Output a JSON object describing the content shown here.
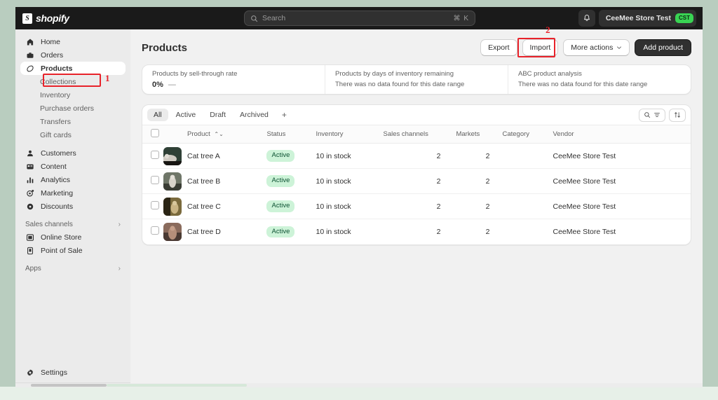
{
  "topbar": {
    "logo_text": "shopify",
    "logo_mark": "S",
    "search_placeholder": "Search",
    "search_shortcut": "⌘ K",
    "bell_icon": "bell-icon",
    "store_name": "CeeMee Store Test",
    "store_badge": "CST"
  },
  "sidebar": {
    "items": [
      {
        "label": "Home",
        "icon": "home-icon",
        "active": false
      },
      {
        "label": "Orders",
        "icon": "orders-icon",
        "active": false
      },
      {
        "label": "Products",
        "icon": "products-tag-icon",
        "active": true
      }
    ],
    "sub_items": [
      {
        "label": "Collections"
      },
      {
        "label": "Inventory"
      },
      {
        "label": "Purchase orders"
      },
      {
        "label": "Transfers"
      },
      {
        "label": "Gift cards"
      }
    ],
    "items2": [
      {
        "label": "Customers",
        "icon": "customers-icon"
      },
      {
        "label": "Content",
        "icon": "content-icon"
      },
      {
        "label": "Analytics",
        "icon": "analytics-icon"
      },
      {
        "label": "Marketing",
        "icon": "marketing-icon"
      },
      {
        "label": "Discounts",
        "icon": "discounts-icon"
      }
    ],
    "sales_channels_label": "Sales channels",
    "channels": [
      {
        "label": "Online Store",
        "icon": "online-store-icon"
      },
      {
        "label": "Point of Sale",
        "icon": "point-of-sale-icon"
      }
    ],
    "apps_label": "Apps",
    "settings_label": "Settings",
    "settings_icon": "gear-icon"
  },
  "page": {
    "title": "Products",
    "export_label": "Export",
    "import_label": "Import",
    "more_actions_label": "More actions",
    "add_product_label": "Add product"
  },
  "annotations": [
    {
      "number": "1",
      "target": "sidebar-item-products"
    },
    {
      "number": "2",
      "target": "import-button"
    }
  ],
  "insights": [
    {
      "label": "Products by sell-through rate",
      "value": "0%",
      "delta": "—",
      "empty": ""
    },
    {
      "label": "Products by days of inventory remaining",
      "value": "",
      "delta": "",
      "empty": "There was no data found for this date range"
    },
    {
      "label": "ABC product analysis",
      "value": "",
      "delta": "",
      "empty": "There was no data found for this date range"
    }
  ],
  "tabs": [
    {
      "label": "All",
      "active": true
    },
    {
      "label": "Active",
      "active": false
    },
    {
      "label": "Draft",
      "active": false
    },
    {
      "label": "Archived",
      "active": false
    }
  ],
  "tab_add_label": "+",
  "tools": {
    "search_filter_icon": "search-filter-icon",
    "sort_icon": "sort-icon"
  },
  "table": {
    "columns": [
      "Product",
      "Status",
      "Inventory",
      "Sales channels",
      "Markets",
      "Category",
      "Vendor"
    ],
    "sort_indicator": "⌃⌄",
    "rows": [
      {
        "product": "Cat tree A",
        "status": "Active",
        "inventory": "10 in stock",
        "sales_channels": "2",
        "markets": "2",
        "category": "",
        "vendor": "CeeMee Store Test",
        "thumb_colors": [
          "#2f4036",
          "#cfcac2",
          "#171512"
        ]
      },
      {
        "product": "Cat tree B",
        "status": "Active",
        "inventory": "10 in stock",
        "sales_channels": "2",
        "markets": "2",
        "category": "",
        "vendor": "CeeMee Store Test",
        "thumb_colors": [
          "#6f7668",
          "#d8d4cb",
          "#3a3d35"
        ]
      },
      {
        "product": "Cat tree C",
        "status": "Active",
        "inventory": "10 in stock",
        "sales_channels": "2",
        "markets": "2",
        "category": "",
        "vendor": "CeeMee Store Test",
        "thumb_colors": [
          "#7a6a3c",
          "#c9b484",
          "#2a2414"
        ]
      },
      {
        "product": "Cat tree D",
        "status": "Active",
        "inventory": "10 in stock",
        "sales_channels": "2",
        "markets": "2",
        "category": "",
        "vendor": "CeeMee Store Test",
        "thumb_colors": [
          "#8a6b5c",
          "#b58f7a",
          "#4a3a33"
        ]
      }
    ]
  }
}
